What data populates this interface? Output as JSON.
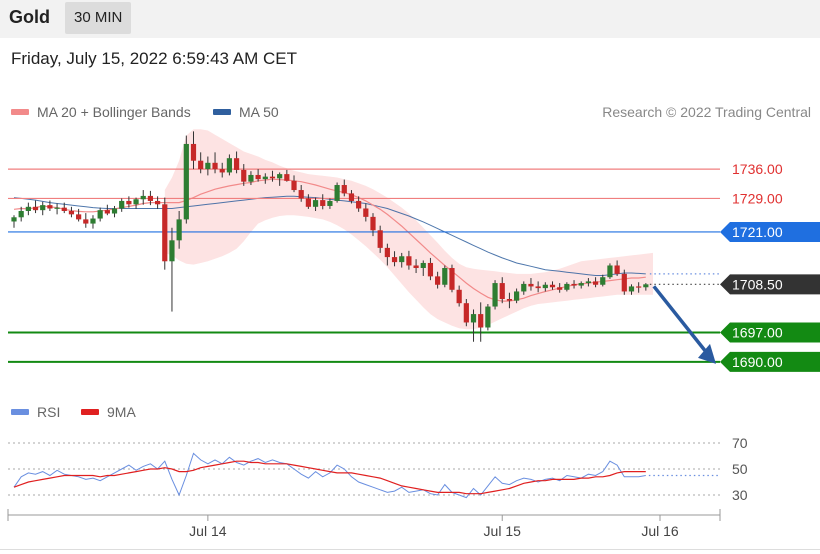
{
  "header": {
    "title": "Gold",
    "interval": "30 MIN"
  },
  "datetime": "Friday, July 15, 2022 6:59:43 AM CET",
  "copyright": "Research © 2022 Trading Central",
  "legend": {
    "ma20": {
      "label": "MA 20 + Bollinger Bands",
      "color": "#f28a8a"
    },
    "ma50": {
      "label": "MA 50",
      "color": "#2f5f9e"
    },
    "rsi": {
      "label": "RSI",
      "color": "#6a8fe0"
    },
    "rsi_ma": {
      "label": "9MA",
      "color": "#e02020"
    }
  },
  "colors": {
    "up": "#2e7d32",
    "down": "#c62828",
    "band": "#fde3e3",
    "support": "#138a13",
    "pivot": "#1f6fe0",
    "resistance": "#f07f7f",
    "arrow": "#2a5aa0",
    "last": "#333333"
  },
  "chart_data": [
    {
      "type": "candlestick",
      "ylim": [
        1684,
        1747
      ],
      "x_ticks": [
        "Jul 14",
        "Jul 15",
        "Jul 16"
      ],
      "levels": [
        {
          "value": 1736.0,
          "label": "1736.00",
          "kind": "resistance"
        },
        {
          "value": 1729.0,
          "label": "1729.00",
          "kind": "resistance"
        },
        {
          "value": 1721.0,
          "label": "1721.00",
          "kind": "pivot"
        },
        {
          "value": 1708.5,
          "label": "1708.50",
          "kind": "last"
        },
        {
          "value": 1697.0,
          "label": "1697.00",
          "kind": "support"
        },
        {
          "value": 1690.0,
          "label": "1690.00",
          "kind": "support"
        }
      ],
      "candles": [
        [
          1723.5,
          1725,
          1722,
          1724.5
        ],
        [
          1724.5,
          1727,
          1723.5,
          1726
        ],
        [
          1726,
          1728,
          1725,
          1727
        ],
        [
          1727,
          1728.5,
          1725.5,
          1726.2
        ],
        [
          1726.2,
          1728.2,
          1725,
          1727.4
        ],
        [
          1727.4,
          1728.5,
          1726,
          1726.6
        ],
        [
          1726.6,
          1727.8,
          1725.2,
          1726.8
        ],
        [
          1726.8,
          1728,
          1725.5,
          1726
        ],
        [
          1726,
          1727,
          1724.5,
          1725.2
        ],
        [
          1725.2,
          1726.5,
          1723.5,
          1724
        ],
        [
          1724,
          1725.5,
          1722,
          1723
        ],
        [
          1723,
          1725,
          1721.8,
          1724.2
        ],
        [
          1724.2,
          1726.8,
          1723.5,
          1726.2
        ],
        [
          1726.2,
          1727.5,
          1725,
          1725.4
        ],
        [
          1725.4,
          1727.2,
          1724.5,
          1726.6
        ],
        [
          1726.6,
          1729,
          1725.8,
          1728.4
        ],
        [
          1728.4,
          1729.5,
          1726.8,
          1727.6
        ],
        [
          1727.6,
          1729.2,
          1726.5,
          1728.8
        ],
        [
          1728.8,
          1731,
          1727.5,
          1729.6
        ],
        [
          1729.6,
          1730.8,
          1727.4,
          1728.4
        ],
        [
          1728.4,
          1729.5,
          1726.5,
          1727.6
        ],
        [
          1727.6,
          1729.2,
          1712,
          1714
        ],
        [
          1714,
          1722,
          1702,
          1719
        ],
        [
          1719,
          1726,
          1717,
          1724
        ],
        [
          1724,
          1744,
          1723,
          1742
        ],
        [
          1742,
          1745,
          1736,
          1738
        ],
        [
          1738,
          1740,
          1735,
          1736
        ],
        [
          1736,
          1739,
          1734.5,
          1737.5
        ],
        [
          1737.5,
          1740,
          1735,
          1736
        ],
        [
          1736,
          1737.5,
          1734,
          1735.2
        ],
        [
          1735.2,
          1739.5,
          1734.5,
          1738.6
        ],
        [
          1738.6,
          1740.2,
          1735,
          1735.8
        ],
        [
          1735.8,
          1737.2,
          1732,
          1733
        ],
        [
          1733,
          1735.5,
          1732.2,
          1734.6
        ],
        [
          1734.6,
          1736,
          1733,
          1733.6
        ],
        [
          1733.6,
          1735,
          1732.5,
          1734.2
        ],
        [
          1734.2,
          1735.6,
          1733,
          1733.8
        ],
        [
          1733.8,
          1735.2,
          1732,
          1734.8
        ],
        [
          1734.8,
          1735.8,
          1733,
          1733.2
        ],
        [
          1733.2,
          1734.5,
          1730.5,
          1731
        ],
        [
          1731,
          1732.2,
          1728.2,
          1729
        ],
        [
          1729,
          1730,
          1726.5,
          1727
        ],
        [
          1727,
          1729.2,
          1726,
          1728.6
        ],
        [
          1728.6,
          1730,
          1726.4,
          1727.2
        ],
        [
          1727.2,
          1729,
          1726.5,
          1728.4
        ],
        [
          1728.4,
          1732.8,
          1728,
          1732.2
        ],
        [
          1732.2,
          1733.5,
          1729.5,
          1730.2
        ],
        [
          1730.2,
          1731,
          1727.8,
          1728.4
        ],
        [
          1728.4,
          1729.5,
          1725.8,
          1726.6
        ],
        [
          1726.6,
          1727.8,
          1723.5,
          1724.6
        ],
        [
          1724.6,
          1725.5,
          1720,
          1721.4
        ],
        [
          1721.4,
          1722.5,
          1716,
          1717.2
        ],
        [
          1717.2,
          1718.2,
          1713,
          1715
        ],
        [
          1715,
          1716.4,
          1712.8,
          1713.8
        ],
        [
          1713.8,
          1716,
          1712.5,
          1715.2
        ],
        [
          1715.2,
          1716.5,
          1712,
          1713
        ],
        [
          1713,
          1714.5,
          1711.2,
          1712.4
        ],
        [
          1712.4,
          1714.2,
          1710.5,
          1713.6
        ],
        [
          1713.6,
          1714.8,
          1709.5,
          1710.4
        ],
        [
          1710.4,
          1711.5,
          1707.5,
          1708.4
        ],
        [
          1708.4,
          1713,
          1707.8,
          1712.4
        ],
        [
          1712.4,
          1713.2,
          1706.6,
          1707.2
        ],
        [
          1707.2,
          1708.2,
          1703.2,
          1704
        ],
        [
          1704,
          1705,
          1698.5,
          1699.4
        ],
        [
          1699.4,
          1702.5,
          1694.8,
          1701.4
        ],
        [
          1701.4,
          1704.2,
          1694.8,
          1698.2
        ],
        [
          1698.2,
          1703.8,
          1697.5,
          1703.2
        ],
        [
          1703.2,
          1709.5,
          1702.5,
          1708.8
        ],
        [
          1708.8,
          1710.2,
          1704,
          1705
        ],
        [
          1705,
          1706.5,
          1702.8,
          1704.6
        ],
        [
          1704.6,
          1707.5,
          1704,
          1706.8
        ],
        [
          1706.8,
          1709.2,
          1706,
          1708.6
        ],
        [
          1708.6,
          1710,
          1707,
          1708
        ],
        [
          1708,
          1709.2,
          1706.6,
          1707.6
        ],
        [
          1707.6,
          1709,
          1706.8,
          1708.4
        ],
        [
          1708.4,
          1709.2,
          1707.2,
          1707.8
        ],
        [
          1707.8,
          1708.8,
          1706.5,
          1707.2
        ],
        [
          1707.2,
          1709,
          1706.8,
          1708.6
        ],
        [
          1708.6,
          1709.5,
          1707.5,
          1708.2
        ],
        [
          1708.2,
          1709.2,
          1707.5,
          1708.8
        ],
        [
          1708.8,
          1710,
          1708,
          1709.2
        ],
        [
          1709.2,
          1710.2,
          1707.8,
          1708.4
        ],
        [
          1708.4,
          1710.8,
          1708,
          1710.2
        ],
        [
          1710.2,
          1713.5,
          1709.8,
          1713
        ],
        [
          1713,
          1714.2,
          1710.5,
          1711
        ],
        [
          1711,
          1712,
          1706,
          1706.8
        ],
        [
          1706.8,
          1708.5,
          1706,
          1708
        ],
        [
          1708,
          1709,
          1706.5,
          1707.8
        ],
        [
          1707.8,
          1708.8,
          1707,
          1708.5
        ]
      ],
      "bands": {
        "start": 21,
        "upper": [
          1731,
          1734,
          1738,
          1744,
          1745.5,
          1745.5,
          1745.2,
          1744.2,
          1743.2,
          1742.2,
          1741.2,
          1740.2,
          1739.6,
          1739,
          1738.2,
          1737.6,
          1736.8,
          1736.2,
          1735.6,
          1735.2,
          1734.8,
          1734.6,
          1734.4,
          1734.2,
          1734,
          1733.6,
          1733.2,
          1732.6,
          1732,
          1731.2,
          1730.2,
          1729.2,
          1728,
          1726.8,
          1725.4,
          1723.8,
          1722,
          1720.2,
          1718.4,
          1716.5,
          1714.8,
          1713.4,
          1712.6,
          1712.2,
          1712,
          1711.8,
          1711.6,
          1711.4,
          1711.2,
          1711,
          1711,
          1711,
          1711.2,
          1711.4,
          1711.8,
          1712.2,
          1712.8,
          1713.4,
          1714,
          1714.2,
          1714.4,
          1714.6,
          1714.8,
          1715,
          1715.2,
          1715.4,
          1715.6,
          1715.8,
          1716
        ],
        "lower": [
          1716,
          1715.4,
          1714.2,
          1713.4,
          1713.2,
          1713.6,
          1714,
          1714.6,
          1715.2,
          1716,
          1717,
          1718.8,
          1721,
          1723,
          1723.8,
          1724.4,
          1724.8,
          1725,
          1725,
          1724.8,
          1724.6,
          1724.3,
          1724,
          1723.4,
          1722.6,
          1721.6,
          1720.4,
          1719,
          1717.6,
          1716,
          1714.4,
          1712.6,
          1710.6,
          1708.6,
          1706.6,
          1704.8,
          1703,
          1701.4,
          1700.2,
          1699.4,
          1698.6,
          1698,
          1697.8,
          1697.8,
          1698.2,
          1698.8,
          1699.6,
          1700.4,
          1701.2,
          1702,
          1702.8,
          1703.4,
          1703.8,
          1704,
          1704.2,
          1704.4,
          1704.6,
          1704.8,
          1705,
          1705.2,
          1705.4,
          1705.6,
          1705.8,
          1706,
          1706,
          1706,
          1706,
          1706,
          1706
        ]
      },
      "ma20": [
        1726.4,
        1726.6,
        1726.5,
        1726.8,
        1727.2,
        1727,
        1726.8,
        1726.4,
        1726.1,
        1725.9,
        1725.8,
        1725.8,
        1726,
        1726.2,
        1726.5,
        1726.8,
        1727.1,
        1727.4,
        1727.8,
        1728,
        1728,
        1728,
        1728,
        1728,
        1728.5,
        1729.2,
        1730,
        1730.6,
        1731.2,
        1731.6,
        1732,
        1732.3,
        1732.6,
        1732.8,
        1733.2,
        1733.4,
        1733.6,
        1733.5,
        1733.4,
        1733.2,
        1733,
        1732.6,
        1732.2,
        1731.7,
        1731.2,
        1730.8,
        1730.4,
        1729.9,
        1729.2,
        1728.4,
        1727.4,
        1726.4,
        1725.2,
        1723.8,
        1722.4,
        1720.8,
        1719.2,
        1717.6,
        1716,
        1714.5,
        1713,
        1711.6,
        1710.2,
        1708.8,
        1707.5,
        1706.4,
        1705.4,
        1704.8,
        1704.5,
        1704.5,
        1704.8,
        1705.2,
        1705.8,
        1706.3,
        1706.8,
        1707.2,
        1707.6,
        1708,
        1708.4,
        1708.6,
        1708.8,
        1709,
        1709.2,
        1709.4,
        1709.6,
        1709.8,
        1710,
        1710,
        1710.2
      ],
      "ma50": [
        1729.2,
        1729,
        1728.8,
        1728.6,
        1728.3,
        1728,
        1727.8,
        1727.6,
        1727.4,
        1727.2,
        1727,
        1726.8,
        1726.7,
        1726.6,
        1726.6,
        1726.6,
        1726.6,
        1726.6,
        1726.6,
        1726.6,
        1726.6,
        1726.6,
        1726.6,
        1726.8,
        1727,
        1727.2,
        1727.4,
        1727.6,
        1727.8,
        1728,
        1728.2,
        1728.4,
        1728.6,
        1728.8,
        1729,
        1729.2,
        1729.3,
        1729.4,
        1729.5,
        1729.5,
        1729.4,
        1729.3,
        1729.2,
        1729,
        1728.8,
        1728.6,
        1728.4,
        1728.2,
        1728,
        1727.8,
        1727.4,
        1727,
        1726.6,
        1726,
        1725.4,
        1724.8,
        1724.1,
        1723.4,
        1722.6,
        1721.8,
        1721,
        1720.2,
        1719.4,
        1718.6,
        1717.8,
        1717,
        1716.2,
        1715.5,
        1714.8,
        1714.2,
        1713.6,
        1713.2,
        1712.8,
        1712.4,
        1712,
        1711.8,
        1711.6,
        1711.4,
        1711.2,
        1711,
        1710.8,
        1710.6,
        1710.6,
        1710.8,
        1711,
        1711.2,
        1711.2,
        1711.1,
        1711
      ]
    },
    {
      "type": "line",
      "ylim": [
        20,
        80
      ],
      "yticks": [
        30,
        50,
        70
      ],
      "series": [
        {
          "name": "RSI",
          "values": [
            36,
            44,
            47,
            46,
            48,
            45,
            49,
            46,
            45,
            44,
            42,
            43,
            41,
            44,
            47,
            50,
            53,
            49,
            52,
            54,
            50,
            56,
            42,
            30,
            45,
            62,
            57,
            54,
            57,
            54,
            59,
            55,
            53,
            56,
            58,
            55,
            57,
            55,
            54,
            50,
            46,
            43,
            48,
            44,
            47,
            53,
            50,
            44,
            40,
            38,
            36,
            34,
            32,
            33,
            36,
            32,
            33,
            34,
            31,
            30,
            38,
            32,
            30,
            28,
            35,
            30,
            37,
            44,
            39,
            38,
            41,
            43,
            42,
            40,
            42,
            43,
            41,
            45,
            44,
            43,
            46,
            45,
            48,
            56,
            53,
            44,
            44,
            44,
            45
          ]
        },
        {
          "name": "9MA",
          "values": [
            36,
            38,
            40,
            41,
            42,
            43,
            44,
            45,
            45,
            45,
            45,
            45,
            44,
            45,
            45,
            46,
            47,
            48,
            49,
            50,
            50,
            51,
            50,
            48,
            48,
            49,
            51,
            52,
            53,
            54,
            55,
            56,
            56,
            55,
            55,
            54,
            54,
            54,
            54,
            53,
            52,
            51,
            50,
            49,
            48,
            47,
            47,
            47,
            46,
            45,
            44,
            43,
            41,
            39,
            37,
            36,
            35,
            34,
            33,
            32,
            32,
            32,
            32,
            31,
            31,
            31,
            32,
            33,
            34,
            35,
            37,
            39,
            40,
            41,
            41,
            42,
            42,
            42,
            42,
            43,
            43,
            44,
            44,
            45,
            47,
            48,
            48,
            48,
            48
          ]
        }
      ]
    }
  ]
}
